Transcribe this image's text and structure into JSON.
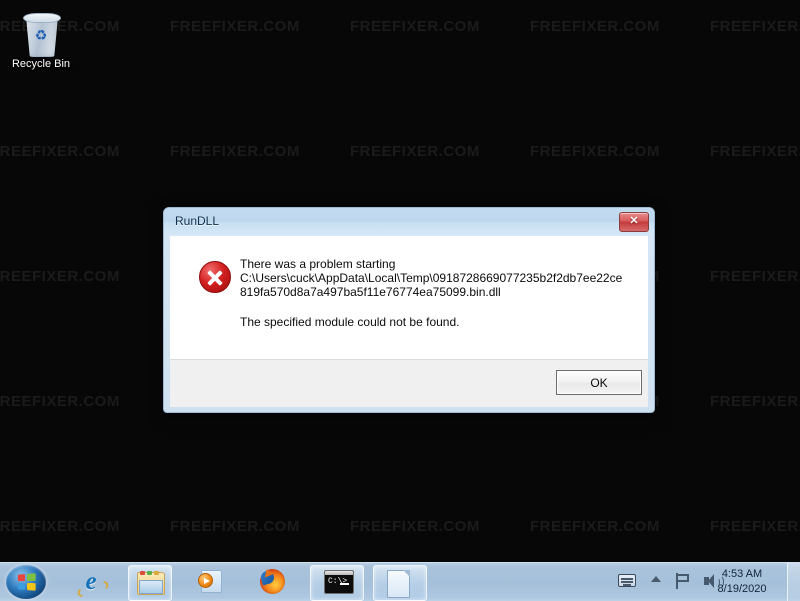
{
  "desktop": {
    "watermark_text": "FREEFIXER.COM",
    "background_color": "#070707",
    "icons": [
      {
        "name": "recycle-bin",
        "label": "Recycle Bin"
      }
    ]
  },
  "dialog": {
    "title": "RunDLL",
    "close_label": "✕",
    "error_icon": "error-x-icon",
    "message_lines": [
      "There was a problem starting",
      "C:\\Users\\cuck\\AppData\\Local\\Temp\\0918728669077235b2f2db7ee22ce",
      "819fa570d8a7a497ba5f11e76774ea75099.bin.dll"
    ],
    "detail_line": "The specified module could not be found.",
    "ok_label": "OK",
    "titlebar_color": "#bcd6ec",
    "close_button_color": "#c33a3a",
    "error_icon_color": "#d42020"
  },
  "taskbar": {
    "start_label": "Start",
    "items": [
      {
        "name": "internet-explorer",
        "label": "Internet Explorer",
        "state": "pinned"
      },
      {
        "name": "windows-explorer",
        "label": "Windows Explorer",
        "state": "active"
      },
      {
        "name": "windows-media-player",
        "label": "Windows Media Player",
        "state": "pinned"
      },
      {
        "name": "firefox",
        "label": "Mozilla Firefox",
        "state": "pinned"
      },
      {
        "name": "command-prompt",
        "label": "Command Prompt",
        "state": "active"
      },
      {
        "name": "document-window",
        "label": "Document",
        "state": "active"
      }
    ],
    "tray": {
      "icons": [
        {
          "name": "ime-keyboard-icon",
          "label": "Input language"
        },
        {
          "name": "show-hidden-icons-icon",
          "label": "Show hidden icons"
        },
        {
          "name": "action-center-flag-icon",
          "label": "Action Center"
        },
        {
          "name": "volume-speaker-icon",
          "label": "Volume"
        }
      ],
      "clock": {
        "time": "4:53 AM",
        "date": "8/19/2020"
      }
    },
    "background_color": "#a5c0da"
  }
}
